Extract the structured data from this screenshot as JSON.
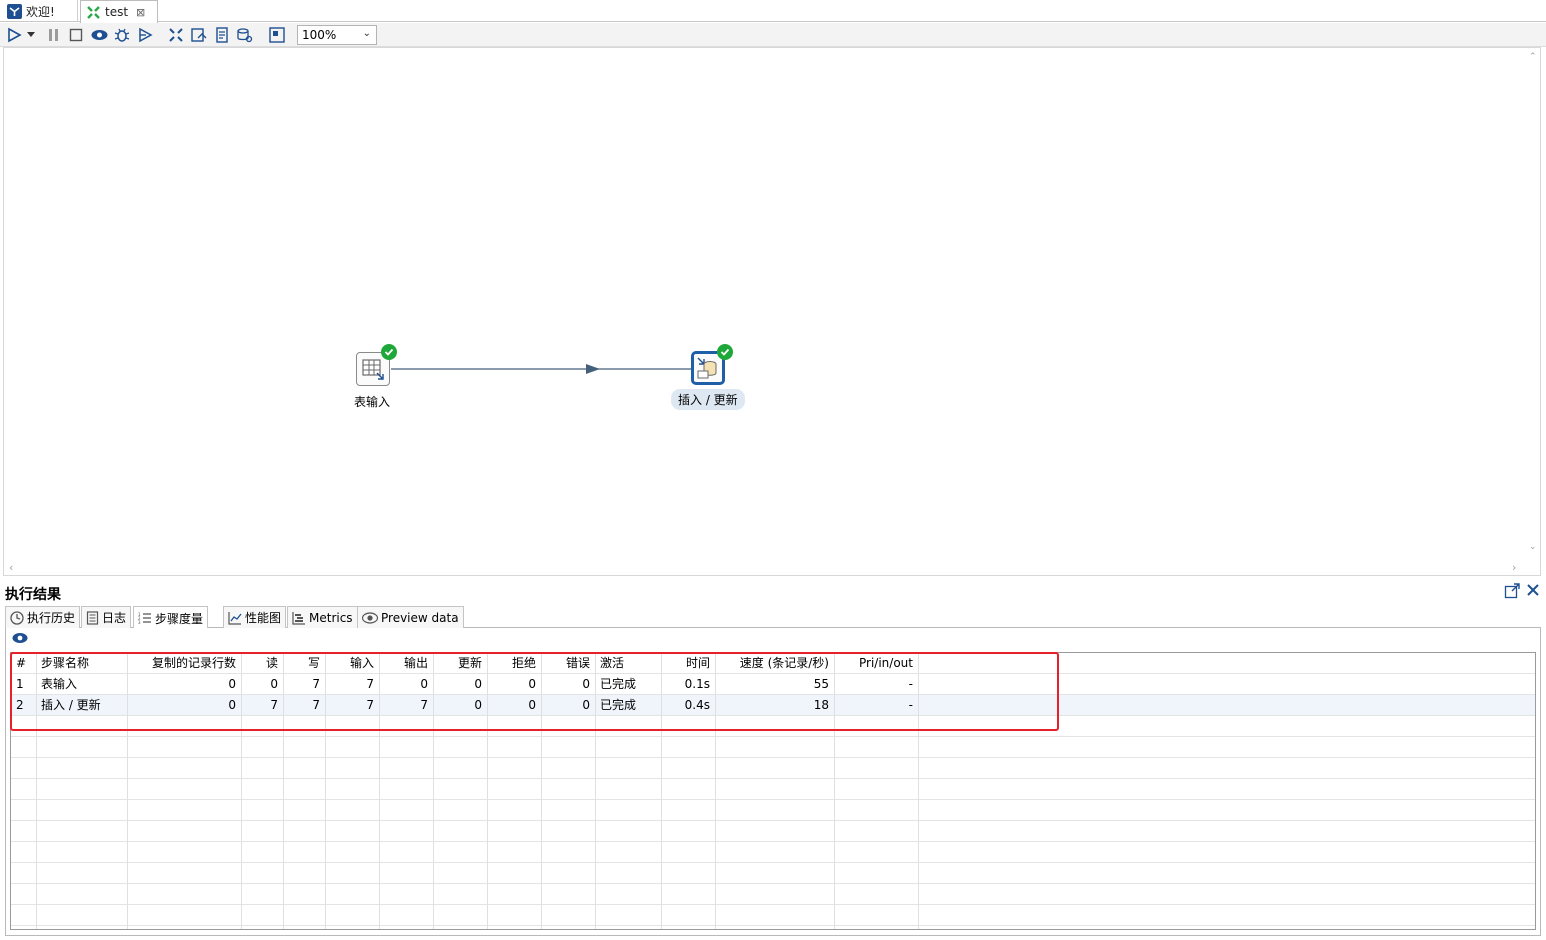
{
  "tabs": [
    {
      "label": "欢迎!"
    },
    {
      "label": "test",
      "close": "⊠"
    }
  ],
  "toolbar": {
    "zoom": "100%"
  },
  "canvas": {
    "steps": [
      {
        "label": "表输入"
      },
      {
        "label": "插入 / 更新"
      }
    ]
  },
  "results": {
    "title": "执行结果",
    "tabs": [
      {
        "label": "执行历史"
      },
      {
        "label": "日志"
      },
      {
        "label": "步骤度量"
      },
      {
        "label": "性能图"
      },
      {
        "label": "Metrics"
      },
      {
        "label": "Preview data"
      }
    ],
    "table": {
      "columns": [
        "#",
        "步骤名称",
        "复制的记录行数",
        "读",
        "写",
        "输入",
        "输出",
        "更新",
        "拒绝",
        "错误",
        "激活",
        "时间",
        "速度 (条记录/秒)",
        "Pri/in/out"
      ],
      "rows": [
        [
          "1",
          "表输入",
          "0",
          "0",
          "7",
          "7",
          "0",
          "0",
          "0",
          "0",
          "已完成",
          "0.1s",
          "55",
          "-"
        ],
        [
          "2",
          "插入 / 更新",
          "0",
          "7",
          "7",
          "7",
          "7",
          "0",
          "0",
          "0",
          "已完成",
          "0.4s",
          "18",
          "-"
        ]
      ]
    }
  },
  "colors": {
    "accent": "#1f5fa8",
    "success": "#1fa83a",
    "highlight": "#e8202a",
    "row_alt": "#eff5fb"
  }
}
